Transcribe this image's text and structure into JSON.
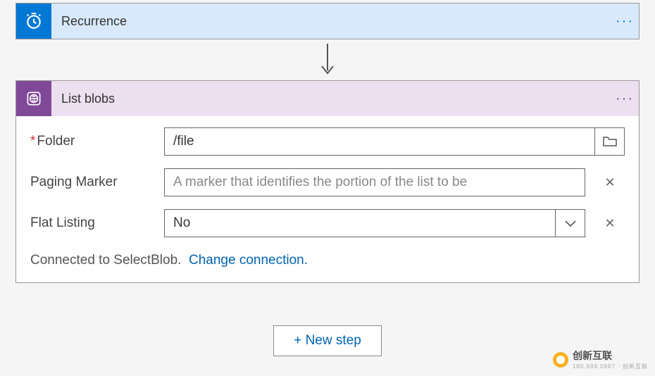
{
  "steps": {
    "recurrence": {
      "title": "Recurrence"
    },
    "listblobs": {
      "title": "List blobs",
      "fields": {
        "folder": {
          "label": "Folder",
          "value": "/file",
          "required": true
        },
        "paging_marker": {
          "label": "Paging Marker",
          "placeholder": "A marker that identifies the portion of the list to be"
        },
        "flat_listing": {
          "label": "Flat Listing",
          "value": "No"
        }
      },
      "connection": {
        "text": "Connected to SelectBlob.",
        "change_label": "Change connection."
      }
    }
  },
  "new_step_label": "+ New step",
  "watermark": {
    "brand": "创新互联",
    "sub": "180.999.0987 · 创新互联"
  },
  "icons": {
    "menu": "···",
    "remove": "✕"
  }
}
